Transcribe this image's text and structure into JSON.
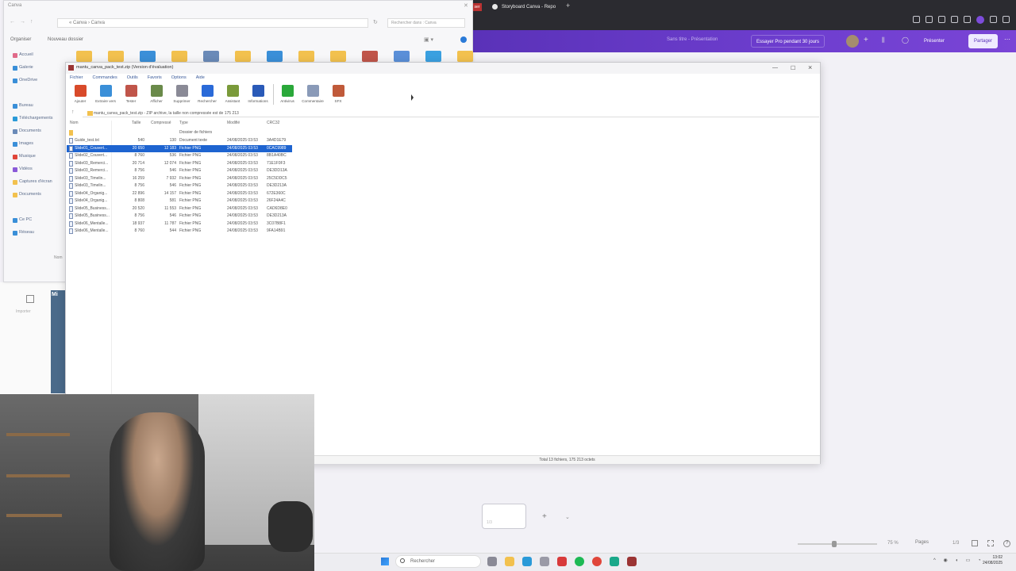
{
  "browser": {
    "tab_label": "Storyboard Canva - Repo",
    "newtab": "+",
    "red_tab": "ser"
  },
  "canva": {
    "file_label": "Sans titre - Présentation",
    "trial_button": "Essayer Pro pendant 30 jours",
    "present_button": "Présenter",
    "share_button": "Partager",
    "add_page": "+",
    "zoom": "75 %",
    "pages_label": "Pages",
    "page_count": "1/3",
    "thumb_text": "Mi",
    "side_label": "Importer",
    "accent": "#6e3ecf"
  },
  "explorer": {
    "title": "Canva",
    "address": "«  Canva  ›  Canva",
    "search_placeholder": "Rechercher dans : Canva",
    "organize": "Organiser",
    "new_folder": "Nouveau dossier",
    "footer": "Nom",
    "sidebar": [
      "Accueil",
      "Galerie",
      "OneDrive",
      "Bureau",
      "Téléchargements",
      "Documents",
      "Images",
      "Musique",
      "Vidéos",
      "Captures d'écran",
      "Documents",
      "Ce PC",
      "Réseau"
    ]
  },
  "winrar": {
    "title": "mantu_canva_pack_test.zip (Version d'évaluation)",
    "menu": [
      "Fichier",
      "Commandes",
      "Outils",
      "Favoris",
      "Options",
      "Aide"
    ],
    "tools": [
      "Ajouter",
      "Extraire vers",
      "Tester",
      "Afficher",
      "Supprimer",
      "Rechercher",
      "Assistant",
      "Informations"
    ],
    "tools2": [
      "Antivirus",
      "Commentaire",
      "SFX"
    ],
    "path": "mantu_canva_pack_test.zip - ZIP archive, la taille non compressée est de 175 213",
    "columns": [
      "Nom",
      "Taille",
      "Compressé",
      "Type",
      "Modifié",
      "CRC32"
    ],
    "up_row": "Dossier de fichiers",
    "rows": [
      {
        "name": "Guide_test.txt",
        "size": "540",
        "packed": "130",
        "type": "Document texte",
        "modified": "24/08/2025 03:53",
        "crc": "3A4D1E79"
      },
      {
        "name": "Slide01_Couvert...",
        "size": "20 650",
        "packed": "12 183",
        "type": "Fichier PNG",
        "modified": "24/08/2025 03:53",
        "crc": "0CAC9989",
        "selected": true
      },
      {
        "name": "Slide02_Couvert...",
        "size": "8 760",
        "packed": "536",
        "type": "Fichier PNG",
        "modified": "24/08/2025 03:53",
        "crc": "8B1A40BC"
      },
      {
        "name": "Slide03_Remerci...",
        "size": "20 714",
        "packed": "12 074",
        "type": "Fichier PNG",
        "modified": "24/08/2025 03:53",
        "crc": "71E1F0F3"
      },
      {
        "name": "Slide03_Remerci...",
        "size": "8 756",
        "packed": "546",
        "type": "Fichier PNG",
        "modified": "24/08/2025 03:53",
        "crc": "DE3DD13A"
      },
      {
        "name": "Slide03_Timelin...",
        "size": "16 259",
        "packed": "7 932",
        "type": "Fichier PNG",
        "modified": "24/08/2025 03:53",
        "crc": "25C5DDC5"
      },
      {
        "name": "Slide03_Timelin...",
        "size": "8 756",
        "packed": "546",
        "type": "Fichier PNG",
        "modified": "24/08/2025 03:53",
        "crc": "DE3D213A"
      },
      {
        "name": "Slide04_Organig...",
        "size": "22 896",
        "packed": "14 157",
        "type": "Fichier PNG",
        "modified": "24/08/2025 03:53",
        "crc": "672E360C"
      },
      {
        "name": "Slide04_Organig...",
        "size": "8 808",
        "packed": "581",
        "type": "Fichier PNG",
        "modified": "24/08/2025 03:53",
        "crc": "26F24A4C"
      },
      {
        "name": "Slide05_Business...",
        "size": "20 520",
        "packed": "11 553",
        "type": "Fichier PNG",
        "modified": "24/08/2025 03:53",
        "crc": "CAD6D8E0"
      },
      {
        "name": "Slide05_Business...",
        "size": "8 756",
        "packed": "546",
        "type": "Fichier PNG",
        "modified": "24/08/2025 03:53",
        "crc": "DE3D213A"
      },
      {
        "name": "Slide06_Mentalle...",
        "size": "18 937",
        "packed": "11 787",
        "type": "Fichier PNG",
        "modified": "24/08/2025 03:53",
        "crc": "3C07B8F1"
      },
      {
        "name": "Slide06_Mentalle...",
        "size": "8 760",
        "packed": "544",
        "type": "Fichier PNG",
        "modified": "24/08/2025 03:53",
        "crc": "9FA14B91"
      }
    ],
    "status": "Total 13 fichiers, 175 213 octets"
  },
  "taskbar": {
    "search": "Rechercher",
    "time": "13:02",
    "date": "24/08/2025"
  }
}
